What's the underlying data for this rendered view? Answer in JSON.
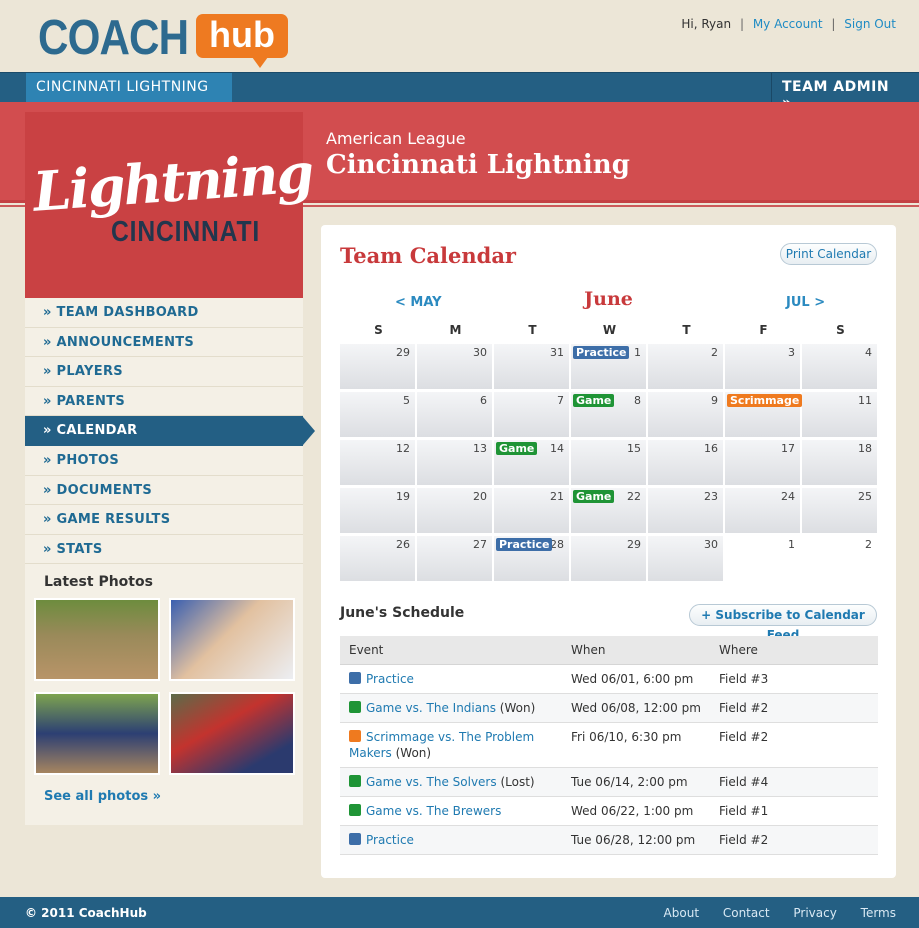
{
  "brand": {
    "coach": "COACH",
    "hub": "hub"
  },
  "user": {
    "greeting": "Hi, Ryan",
    "sep": "|",
    "account": "My Account",
    "signout": "Sign Out"
  },
  "nav": {
    "team_select": "CINCINNATI LIGHTNING",
    "chevron": "⌄",
    "team_admin": "TEAM ADMIN »"
  },
  "banner": {
    "league": "American League",
    "team": "Cincinnati Lightning"
  },
  "team_logo": {
    "script": "Lightning",
    "city": "CINCINNATI"
  },
  "sidebar": {
    "menu": [
      "» TEAM DASHBOARD",
      "» ANNOUNCEMENTS",
      "» PLAYERS",
      "» PARENTS",
      "» CALENDAR",
      "» PHOTOS",
      "» DOCUMENTS",
      "» GAME RESULTS",
      "» STATS"
    ],
    "active_index": 4,
    "latest_photos": "Latest Photos",
    "see_all": "See all photos »"
  },
  "calendar": {
    "title": "Team Calendar",
    "print": "Print Calendar",
    "prev": "< MAY",
    "month": "June",
    "next": "JUL >",
    "dow": [
      "S",
      "M",
      "T",
      "W",
      "T",
      "F",
      "S"
    ],
    "weeks": [
      [
        {
          "d": "29"
        },
        {
          "d": "30"
        },
        {
          "d": "31"
        },
        {
          "d": "1",
          "ev": "Practice",
          "type": "practice"
        },
        {
          "d": "2"
        },
        {
          "d": "3"
        },
        {
          "d": "4"
        }
      ],
      [
        {
          "d": "5"
        },
        {
          "d": "6"
        },
        {
          "d": "7"
        },
        {
          "d": "8",
          "ev": "Game",
          "type": "game"
        },
        {
          "d": "9"
        },
        {
          "d": "10",
          "ev": "Scrimmage",
          "type": "scrimmage"
        },
        {
          "d": "11"
        }
      ],
      [
        {
          "d": "12"
        },
        {
          "d": "13"
        },
        {
          "d": "14",
          "ev": "Game",
          "type": "game"
        },
        {
          "d": "15"
        },
        {
          "d": "16"
        },
        {
          "d": "17"
        },
        {
          "d": "18"
        }
      ],
      [
        {
          "d": "19"
        },
        {
          "d": "20"
        },
        {
          "d": "21"
        },
        {
          "d": "22",
          "ev": "Game",
          "type": "game"
        },
        {
          "d": "23"
        },
        {
          "d": "24"
        },
        {
          "d": "25"
        }
      ],
      [
        {
          "d": "26"
        },
        {
          "d": "27"
        },
        {
          "d": "28",
          "ev": "Practice",
          "type": "practice"
        },
        {
          "d": "29"
        },
        {
          "d": "30"
        },
        {
          "d": "1",
          "blank": true
        },
        {
          "d": "2",
          "blank": true
        }
      ]
    ],
    "colors": {
      "practice": "#3d6ea8",
      "game": "#1f9436",
      "scrimmage": "#ef7a1f"
    }
  },
  "schedule": {
    "title": "June's Schedule",
    "subscribe": "+ Subscribe to Calendar Feed",
    "headers": [
      "Event",
      "When",
      "Where"
    ],
    "rows": [
      {
        "type": "practice",
        "event": "Practice",
        "result": "",
        "when": "Wed 06/01, 6:00 pm",
        "where": "Field #3"
      },
      {
        "type": "game",
        "event": "Game vs. The Indians",
        "result": "(Won)",
        "when": "Wed 06/08, 12:00 pm",
        "where": "Field #2"
      },
      {
        "type": "scrimmage",
        "event": "Scrimmage vs. The Problem Makers",
        "result": "(Won)",
        "when": "Fri 06/10, 6:30 pm",
        "where": "Field #2"
      },
      {
        "type": "game",
        "event": "Game vs. The Solvers",
        "result": "(Lost)",
        "when": "Tue 06/14, 2:00 pm",
        "where": "Field #4"
      },
      {
        "type": "game",
        "event": "Game vs. The Brewers",
        "result": "",
        "when": "Wed 06/22, 1:00 pm",
        "where": "Field #1"
      },
      {
        "type": "practice",
        "event": "Practice",
        "result": "",
        "when": "Tue 06/28, 12:00 pm",
        "where": "Field #2"
      }
    ]
  },
  "footer": {
    "copyright": "© 2011 CoachHub",
    "links": [
      "About",
      "Contact",
      "Privacy",
      "Terms"
    ]
  }
}
